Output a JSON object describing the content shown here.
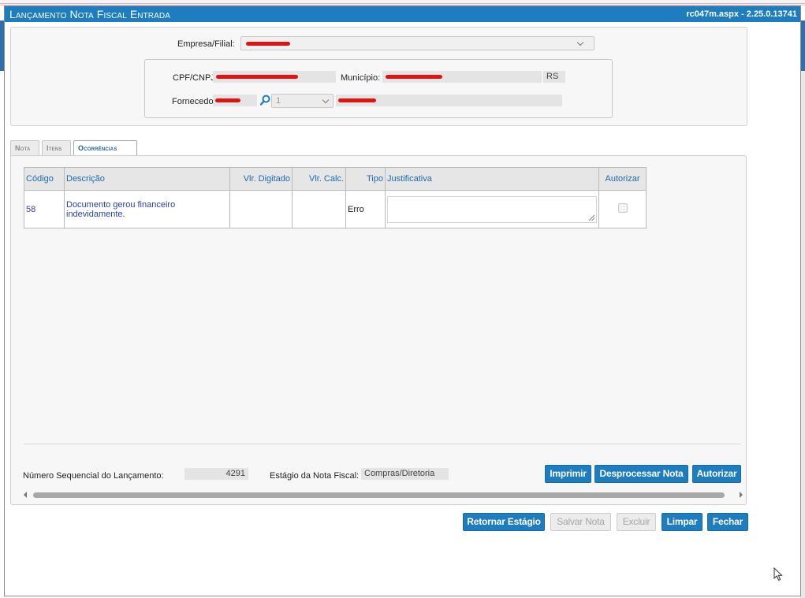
{
  "window": {
    "title": "Lançamento Nota Fiscal Entrada",
    "version": "rc047m.aspx - 2.25.0.13741"
  },
  "header": {
    "empresa_label": "Empresa/Filial:",
    "cpf_label": "CPF/CNPJ:",
    "municipio_label": "Município:",
    "uf_value": "RS",
    "fornecedor_label": "Fornecedor:",
    "fornecedor_select_value": "1"
  },
  "tabs": [
    {
      "label": "Nota"
    },
    {
      "label": "Itens"
    },
    {
      "label": "Ocorrências"
    }
  ],
  "table": {
    "columns": [
      "Código",
      "Descrição",
      "Vlr. Digitado",
      "Vlr. Calc.",
      "Tipo",
      "Justificativa",
      "Autorizar"
    ],
    "rows": [
      {
        "codigo": "58",
        "descricao": "Documento gerou financeiro indevidamente.",
        "vlr_digitado": "",
        "vlr_calc": "",
        "tipo": "Erro",
        "justificativa": ""
      }
    ]
  },
  "footer": {
    "seq_label": "Número Sequencial do Lançamento:",
    "seq_value": "4291",
    "estagio_label": "Estágio da Nota Fiscal:",
    "estagio_value": "Compras/Diretoria"
  },
  "panel_buttons": {
    "imprimir": "Imprimir",
    "desprocessar": "Desprocessar Nota",
    "autorizar": "Autorizar"
  },
  "bottom_buttons": {
    "retornar": "Retornar Estágio",
    "salvar": "Salvar Nota",
    "excluir": "Excluir",
    "limpar": "Limpar",
    "fechar": "Fechar"
  },
  "colors": {
    "primary": "#1d7dbf",
    "redaction": "#e01212"
  }
}
